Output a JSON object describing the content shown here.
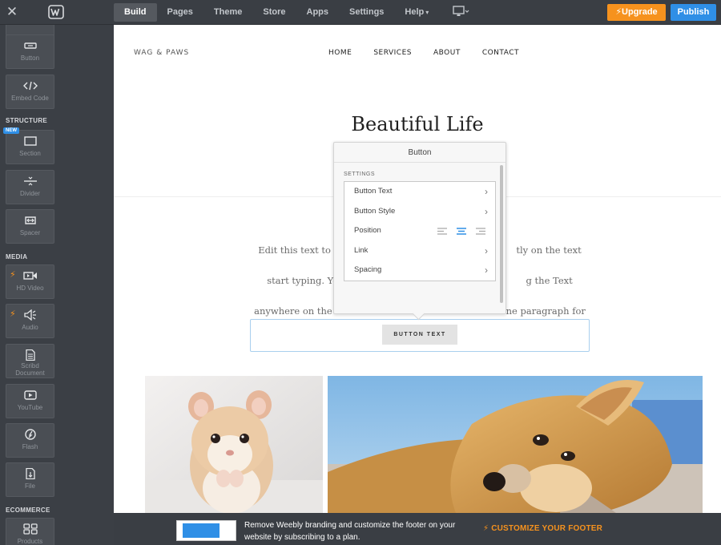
{
  "topbar": {
    "close_icon": "close-icon",
    "logo_icon": "weebly-logo-icon",
    "tabs": [
      {
        "label": "Build",
        "active": true
      },
      {
        "label": "Pages",
        "active": false
      },
      {
        "label": "Theme",
        "active": false
      },
      {
        "label": "Store",
        "active": false
      },
      {
        "label": "Apps",
        "active": false
      },
      {
        "label": "Settings",
        "active": false
      },
      {
        "label": "Help",
        "active": false
      }
    ],
    "device_icon": "monitor-icon",
    "upgrade_label": "Upgrade",
    "publish_label": "Publish",
    "colors": {
      "upgrade": "#f6921e",
      "publish": "#2f8fe6"
    }
  },
  "sidebar": {
    "items": [
      {
        "label": "Button",
        "icon": "button-icon"
      },
      {
        "label": "Embed Code",
        "icon": "code-icon"
      },
      {
        "label": "Section",
        "icon": "section-icon",
        "badge": "NEW"
      },
      {
        "label": "Divider",
        "icon": "divider-icon"
      },
      {
        "label": "Spacer",
        "icon": "spacer-icon"
      },
      {
        "label": "HD Video",
        "icon": "video-icon"
      },
      {
        "label": "Audio",
        "icon": "audio-icon"
      },
      {
        "label": "Scribd Document",
        "icon": "document-icon"
      },
      {
        "label": "YouTube",
        "icon": "youtube-icon"
      },
      {
        "label": "Flash",
        "icon": "flash-icon"
      },
      {
        "label": "File",
        "icon": "file-icon"
      },
      {
        "label": "Products",
        "icon": "products-icon"
      }
    ],
    "sections": [
      "STRUCTURE",
      "MEDIA",
      "ECOMMERCE"
    ]
  },
  "site": {
    "logo": "WAG & PAWS",
    "nav": [
      "HOME",
      "SERVICES",
      "ABOUT",
      "CONTACT"
    ],
    "title": "Beautiful Life",
    "body_text": "Edit this text to ma... tly on the text and start typing. You ca... g the Text Element anywhere on the ... one paragraph for",
    "body_lines": [
      "Edit this text to ma",
      "tly on the text and",
      "start typing. You ca",
      "g the Text Element",
      "anywhere on the",
      "one paragraph for"
    ],
    "button_text": "BUTTON TEXT"
  },
  "popup": {
    "title": "Button",
    "section": "SETTINGS",
    "rows": [
      {
        "label": "Button Text"
      },
      {
        "label": "Button Style"
      },
      {
        "label": "Position",
        "selected_alignment": "center"
      },
      {
        "label": "Link"
      },
      {
        "label": "Spacing"
      }
    ]
  },
  "footer": {
    "message_line1": "Remove Weebly branding and customize the footer on your",
    "message_line2": "website by subscribing to a plan.",
    "cta": "CUSTOMIZE YOUR FOOTER",
    "cta_icon": "lightning-icon"
  }
}
